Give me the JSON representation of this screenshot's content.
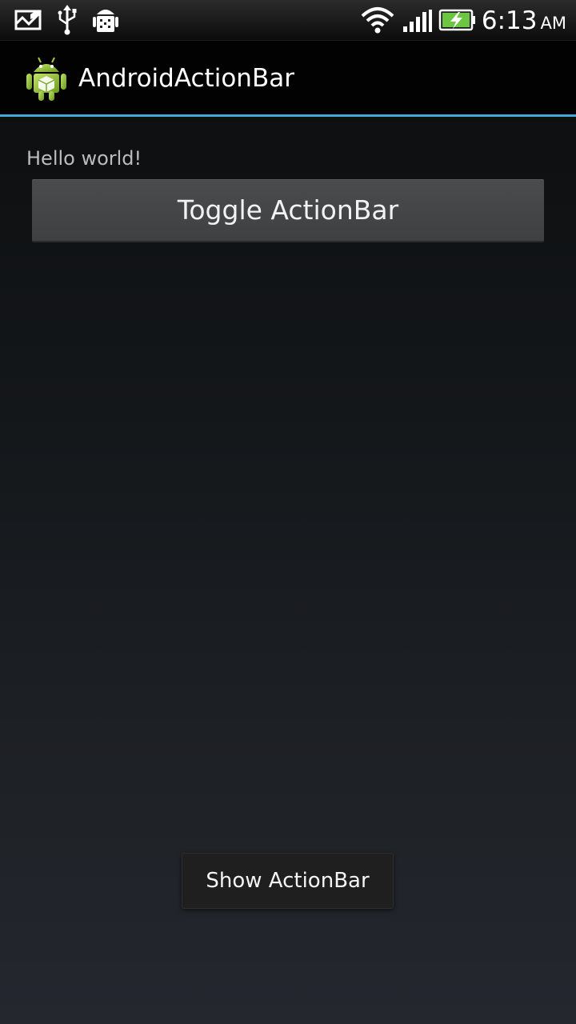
{
  "status_bar": {
    "icons_left": [
      "photo-icon",
      "usb-icon",
      "android-debug-icon"
    ],
    "icons_right": [
      "wifi-icon",
      "signal-icon",
      "battery-charging-icon"
    ],
    "time": "6:13",
    "ampm": "AM"
  },
  "action_bar": {
    "title": "AndroidActionBar",
    "icon": "android-app-icon",
    "divider_color": "#3fa9dc"
  },
  "content": {
    "hello_text": "Hello world!",
    "toggle_button_label": "Toggle ActionBar"
  },
  "toast": {
    "label": "Show ActionBar"
  }
}
